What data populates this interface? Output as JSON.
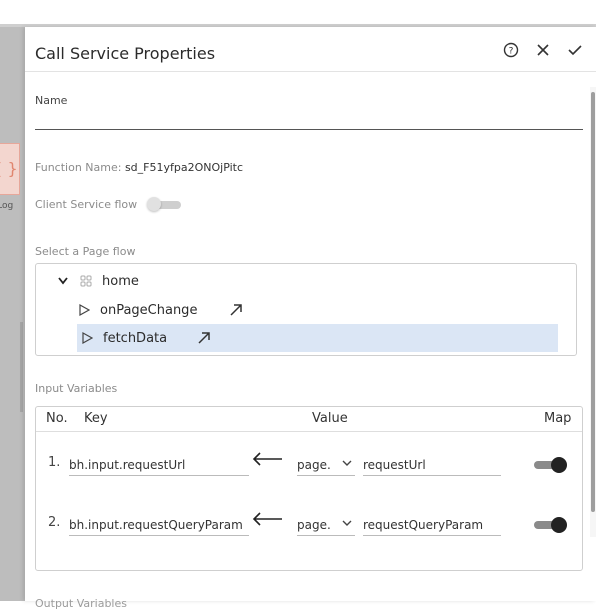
{
  "canvas": {
    "node_icon": "{ }",
    "node_label": "fLog"
  },
  "panel": {
    "title": "Call Service Properties",
    "icons": [
      "help-icon",
      "close-icon",
      "check-icon"
    ]
  },
  "name_field": {
    "label": "Name",
    "value": ""
  },
  "function_name": {
    "label": "Function Name:",
    "value": "sd_F51yfpa2ONOjPitc"
  },
  "client_service_flow": {
    "label": "Client Service flow",
    "enabled": false
  },
  "page_flow": {
    "label": "Select a Page flow",
    "root": {
      "label": "home",
      "expanded": true
    },
    "children": [
      {
        "label": "onPageChange",
        "selected": false
      },
      {
        "label": "fetchData",
        "selected": true
      }
    ]
  },
  "input_variables": {
    "label": "Input Variables",
    "columns": {
      "no": "No.",
      "key": "Key",
      "value": "Value",
      "map": "Map"
    },
    "rows": [
      {
        "no": "1.",
        "key": "bh.input.requestUrl",
        "source": "page.",
        "value": "requestUrl",
        "map": true
      },
      {
        "no": "2.",
        "key": "bh.input.requestQueryParam",
        "source": "page.",
        "value": "requestQueryParam",
        "map": true
      }
    ]
  },
  "output_variables": {
    "label": "Output Variables"
  },
  "colors": {
    "selection": "#dbe6f5",
    "canvas_bg": "#bdbdbd",
    "node_accent": "#e0866f"
  }
}
